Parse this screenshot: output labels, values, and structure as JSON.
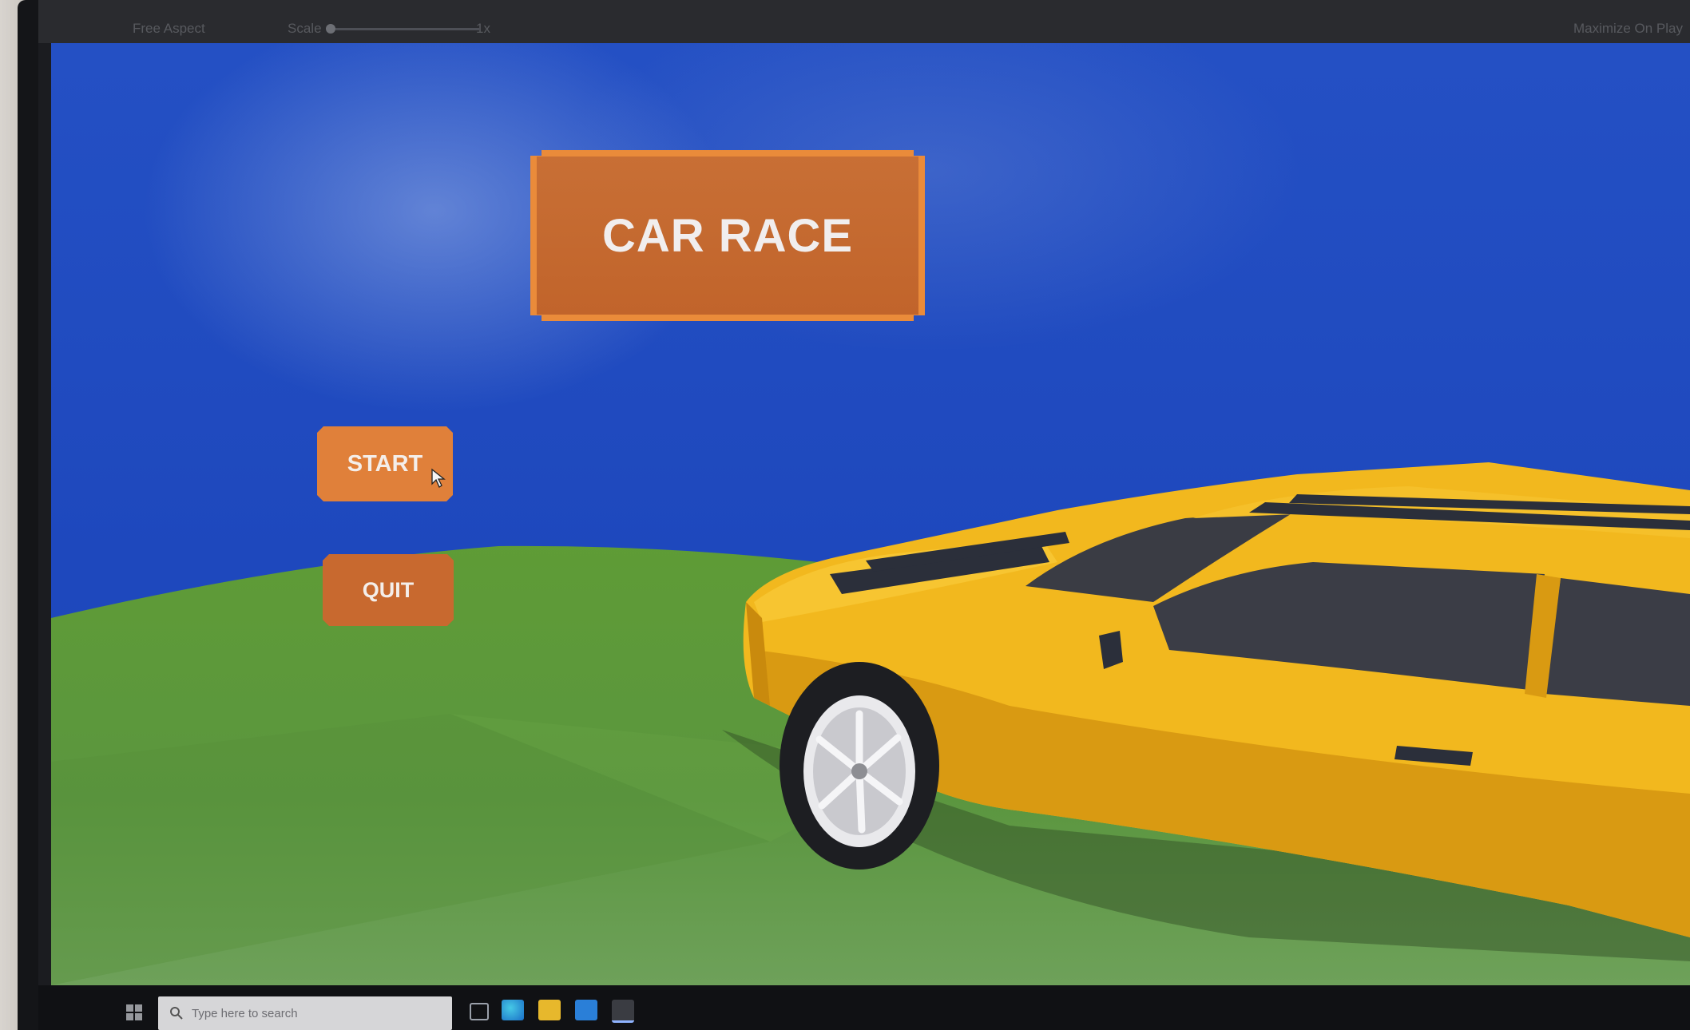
{
  "game": {
    "title": "CAR RACE",
    "menu": {
      "start_label": "START",
      "quit_label": "QUIT"
    }
  },
  "editor": {
    "display_label": "Free Aspect",
    "scale_label": "Scale",
    "scale_value": "1x",
    "right_label": "Maximize On Play"
  },
  "taskbar": {
    "search_placeholder": "Type here to search",
    "icons": [
      "start-windows-icon",
      "task-view-icon",
      "edge-browser-icon",
      "file-explorer-icon",
      "mail-icon",
      "unity-icon"
    ]
  },
  "colors": {
    "sky": "#1f49b8",
    "grass": "#5e9a3a",
    "button_orange": "#e0803a",
    "banner_orange": "#c86f35",
    "banner_border": "#ea8b3a",
    "car_yellow": "#f2b81e"
  }
}
